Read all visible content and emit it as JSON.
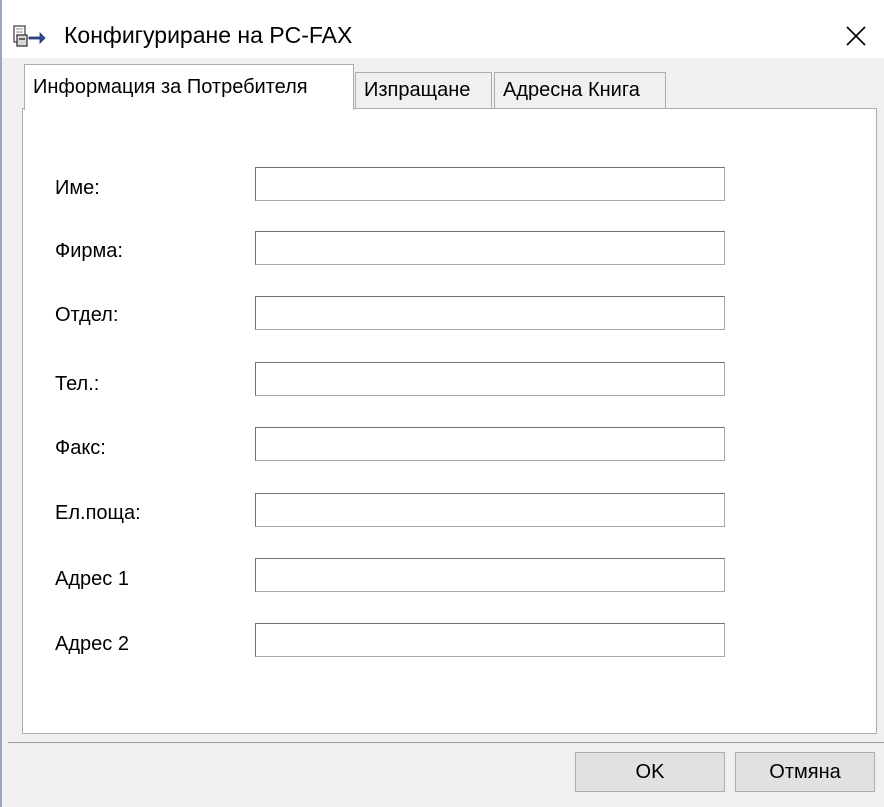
{
  "window": {
    "title": "Конфигуриране на PC-FAX",
    "app_icon": "fax-icon",
    "close_icon": "close-icon"
  },
  "tabs": [
    {
      "label": "Информация за Потребителя",
      "active": true
    },
    {
      "label": "Изпращане",
      "active": false
    },
    {
      "label": "Адресна Книга",
      "active": false
    }
  ],
  "fields": [
    {
      "label": "Име:",
      "value": ""
    },
    {
      "label": "Фирма:",
      "value": ""
    },
    {
      "label": "Отдел:",
      "value": ""
    },
    {
      "label": "Тел.:",
      "value": ""
    },
    {
      "label": "Факс:",
      "value": ""
    },
    {
      "label": "Ел.поща:",
      "value": ""
    },
    {
      "label": "Адрес 1",
      "value": ""
    },
    {
      "label": "Адрес 2",
      "value": ""
    }
  ],
  "buttons": {
    "ok_label": "OK",
    "cancel_label": "Отмяна"
  }
}
